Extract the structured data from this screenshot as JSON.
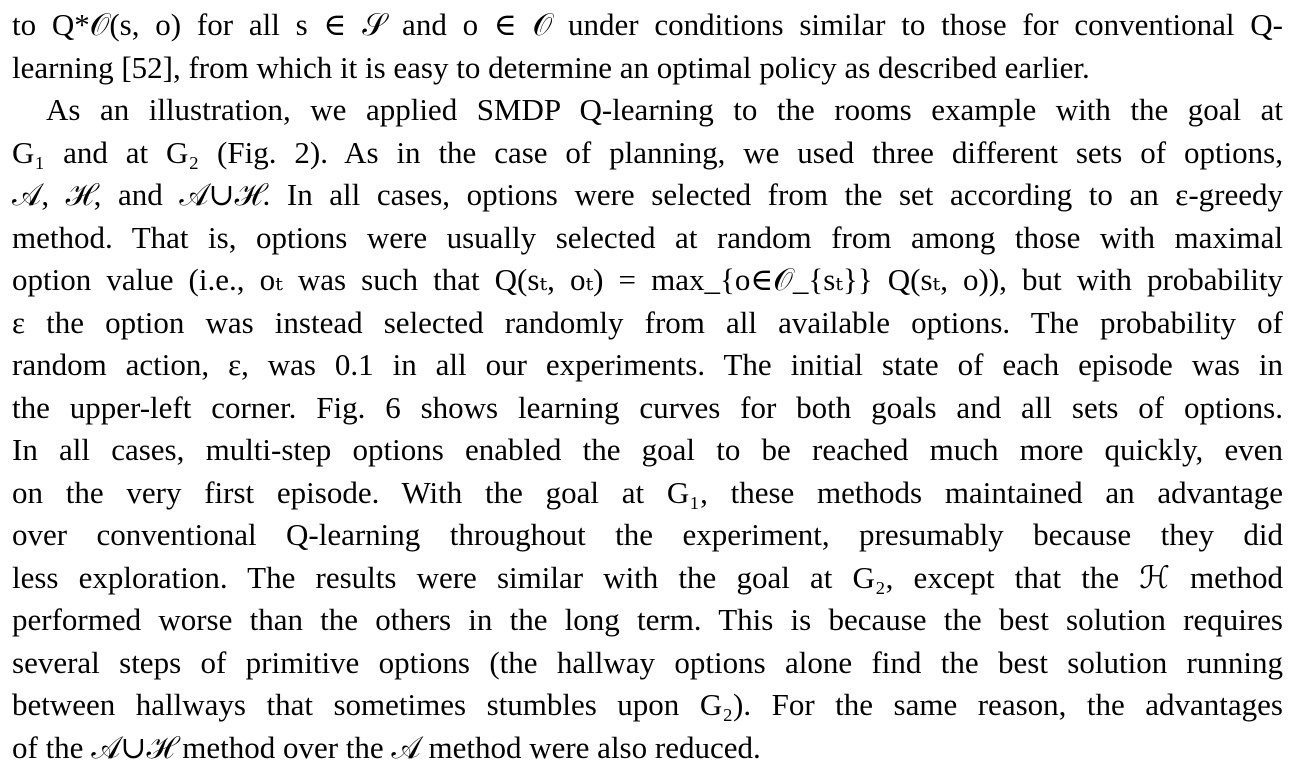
{
  "paper": {
    "lines": [
      "to Q*𝒪(s, o) for all s ∈ 𝒮 and o ∈ 𝒪 under conditions similar to those for conventional Q-",
      "learning [52], from which it is easy to determine an optimal policy as described earlier.",
      "As an illustration, we applied SMDP Q-learning to the rooms example with the goal at",
      "G₁ and at G₂ (Fig. 2). As in the case of planning, we used three different sets of options,",
      "𝒜, ℋ, and 𝒜∪ℋ. In all cases, options were selected from the set according to an ε-greedy",
      "method. That is, options were usually selected at random from among those with maximal",
      "option value (i.e., oₜ was such that Q(sₜ, oₜ) = max_{o∈𝒪_{sₜ}} Q(sₜ, o)), but with probability",
      "ε the option was instead selected randomly from all available options. The probability of",
      "random action, ε, was 0.1 in all our experiments. The initial state of each episode was in",
      "the upper-left corner. Fig. 6 shows learning curves for both goals and all sets of options.",
      "In all cases, multi-step options enabled the goal to be reached much more quickly, even",
      "on the very first episode. With the goal at G₁, these methods maintained an advantage",
      "over conventional Q-learning throughout the experiment, presumably because they did",
      "less exploration. The results were similar with the goal at G₂, except that the ℋ method",
      "performed worse than the others in the long term. This is because the best solution requires",
      "several steps of primitive options (the hallway options alone find the best solution running",
      "between hallways that sometimes stumbles upon G₂). For the same reason, the advantages",
      "of the 𝒜∪ℋ method over the 𝒜 method were also reduced."
    ]
  }
}
